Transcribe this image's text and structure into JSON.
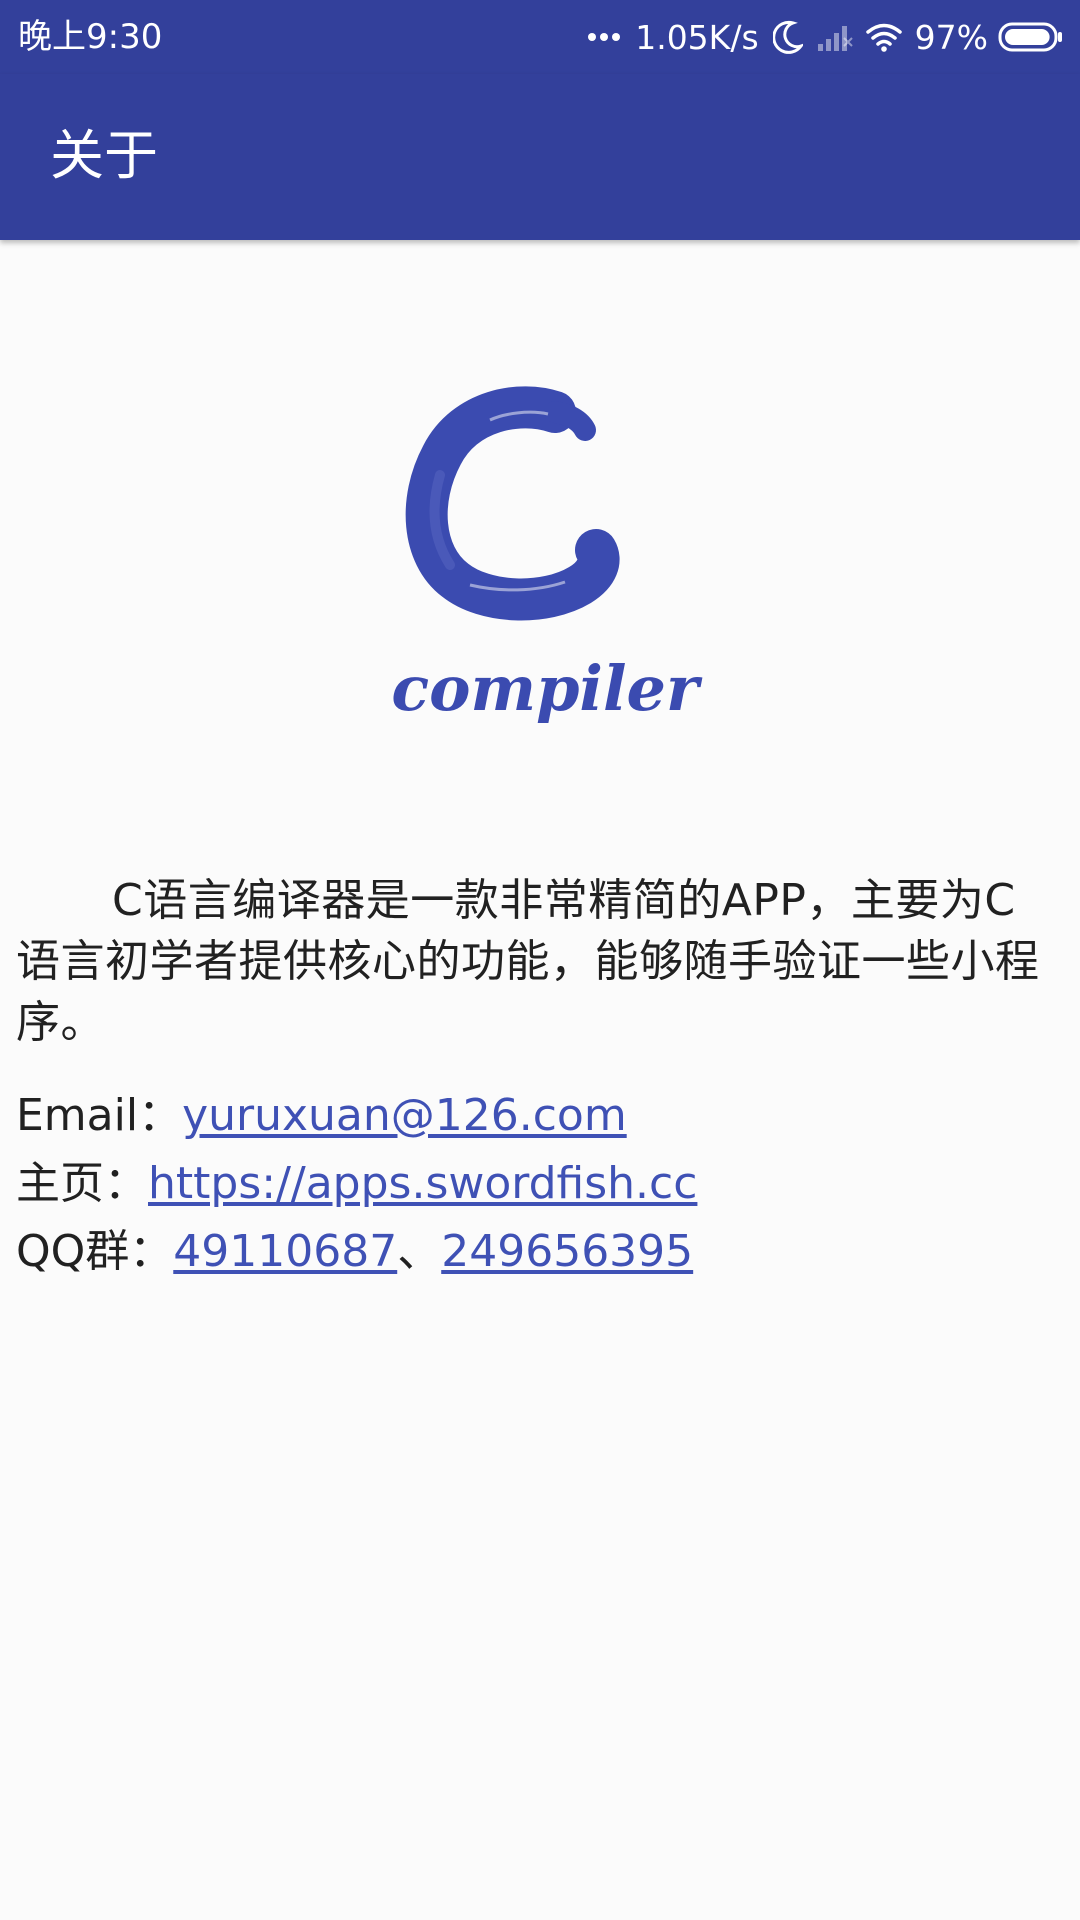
{
  "status_bar": {
    "time": "晚上9:30",
    "speed": "1.05K/s",
    "battery_percent": "97%",
    "battery_level": 0.97,
    "icons": [
      "more-dots-icon",
      "moon-icon",
      "signal-icon",
      "wifi-icon",
      "battery-icon"
    ]
  },
  "app_bar": {
    "title": "关于"
  },
  "logo": {
    "letter": "C",
    "word": "compiler"
  },
  "about": {
    "description": "C语言编译器是一款非常精简的APP，主要为C语言初学者提供核心的功能，能够随手验证一些小程序。"
  },
  "contacts": {
    "email_label": "Email：",
    "email": "yuruxuan@126.com",
    "homepage_label": "主页：",
    "homepage": "https://apps.swordfish.cc",
    "qq_label": "QQ群：",
    "qq_group_1": "49110687",
    "qq_separator": "、",
    "qq_group_2": "249656395"
  },
  "colors": {
    "primary": "#33409b",
    "link": "#3f51b5",
    "logo": "#3b4bb0",
    "text": "#212121",
    "background": "#fbfbfb"
  }
}
